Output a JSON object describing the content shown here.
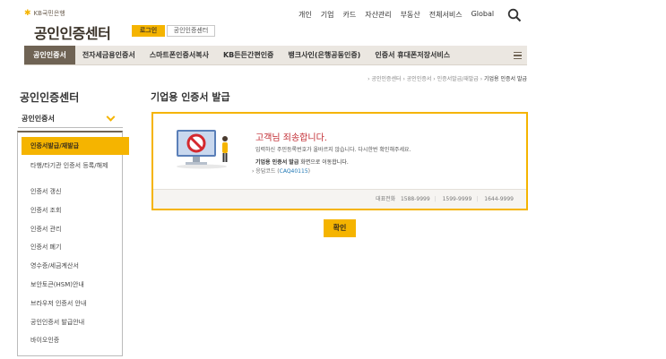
{
  "header": {
    "brand": "KB국민은행",
    "site_title": "공인인증센터",
    "login_label": "로그인",
    "cert_center_label": "공인인증센터",
    "topnav": [
      "개인",
      "기업",
      "카드",
      "자산관리",
      "부동산",
      "전체서비스",
      "Global"
    ]
  },
  "mainnav": {
    "items": [
      "공인인증서",
      "전자세금용인증서",
      "스마트폰인증서복사",
      "KB든든간편인증",
      "뱅크사인(은행공동인증)",
      "인증서 휴대폰저장서비스"
    ]
  },
  "breadcrumb": {
    "items": [
      "공인인증센터",
      "공인인증서",
      "인증서발급/재발급"
    ],
    "current": "기업용 인증서 발급"
  },
  "sidebar": {
    "title": "공인인증센터",
    "select_label": "공인인증서",
    "items": [
      "인증서발급/재발급",
      "타행/타기관 인증서 등록/해제",
      "인증서 갱신",
      "인증서 조회",
      "인증서 관리",
      "인증서 폐기",
      "영수증/세금계산서",
      "보안토큰(HSM)안내",
      "브라우저 인증서 안내",
      "공인인증서 발급안내",
      "바이오인증"
    ]
  },
  "content": {
    "page_title": "기업용 인증서 발급",
    "alert": {
      "headline": "고객님 죄송합니다.",
      "message": "입력하신 주민등록번호가 올바르지 않습니다. 다시한번 확인해주세요.",
      "next_bold": "기업용 인증서 발급",
      "next_rest": " 화면으로 이동합니다.",
      "code_label": "› 응답코드 (",
      "code_value": "CAQ40115",
      "code_close": ")",
      "phone_label": "대표전화",
      "phones": [
        "1588-9999",
        "1599-9999",
        "1644-9999"
      ]
    },
    "confirm_label": "확인"
  },
  "colors": {
    "accent": "#f5b400",
    "nav_active": "#6f6354",
    "error": "#c0262d"
  }
}
